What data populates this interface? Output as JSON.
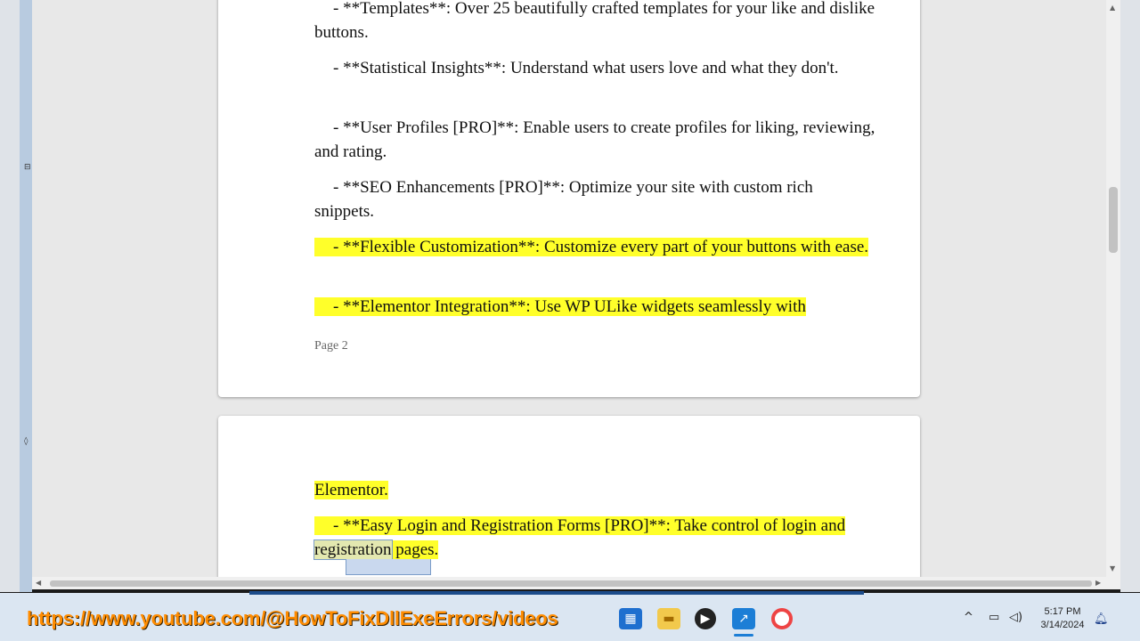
{
  "document": {
    "page1": {
      "paragraphs": [
        {
          "prefix": "- ",
          "text": "**Templates**: Over 25 beautifully crafted templates for your like and dislike buttons.",
          "highlight": false
        },
        {
          "prefix": "- ",
          "text": "**Statistical Insights**: Understand what users love and what they don't.",
          "highlight": false
        },
        {
          "prefix": "- ",
          "text": "**User Profiles [PRO]**: Enable users to create profiles for liking, reviewing, and rating.",
          "highlight": false
        },
        {
          "prefix": "- ",
          "text": "**SEO Enhancements [PRO]**: Optimize your site with custom rich snippets.",
          "highlight": false
        },
        {
          "prefix": "- ",
          "text": "**Flexible Customization**: Customize every part of your buttons with ease.",
          "highlight": true
        },
        {
          "prefix": "- ",
          "text": "**Elementor Integration**: Use WP ULike widgets seamlessly with",
          "highlight": true
        }
      ],
      "page_label": "Page 2"
    },
    "page2": {
      "line1": "Elementor.",
      "para2_prefix": "- ",
      "para2_text_a": "**Easy Login and Registration Forms [PRO]**: Take control of login and ",
      "para2_selected": "registration",
      "para2_text_b": " pages."
    }
  },
  "taskbar": {
    "overlay_url": "https://www.youtube.com/@HowToFixDllExeErrors/videos",
    "icons": [
      "store-icon",
      "file-explorer-icon",
      "media-player-icon",
      "activity-icon",
      "chrome-icon"
    ],
    "time": "5:17 PM",
    "date": "3/14/2024"
  },
  "colors": {
    "highlight": "#ffff2a",
    "overlay_url": "#ff8c00"
  }
}
